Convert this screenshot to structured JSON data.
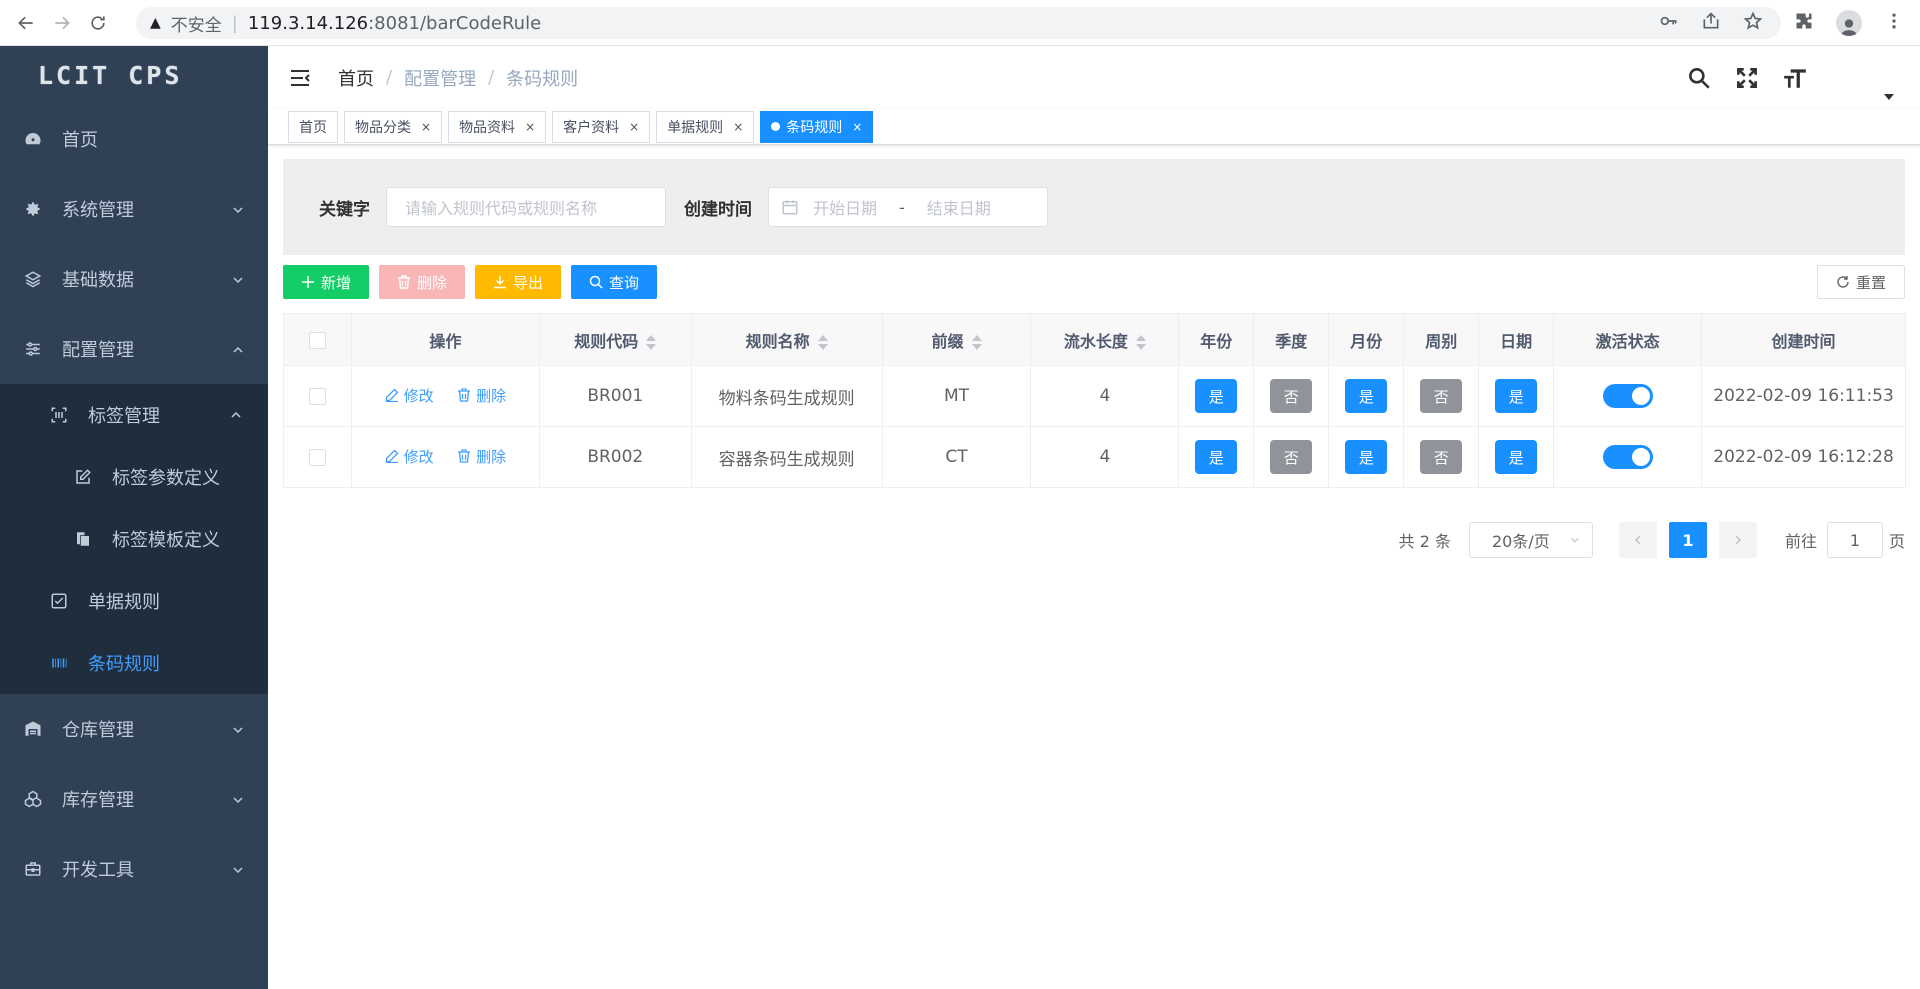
{
  "browser": {
    "insecure_label": "不安全",
    "url_host": "119.3.14.126",
    "url_rest": ":8081/barCodeRule"
  },
  "sidebar": {
    "logo": "LCIT CPS",
    "items": [
      {
        "label": "首页",
        "icon": "dashboard-icon"
      },
      {
        "label": "系统管理",
        "icon": "gear-icon"
      },
      {
        "label": "基础数据",
        "icon": "layers-icon"
      },
      {
        "label": "配置管理",
        "icon": "sliders-icon"
      },
      {
        "label": "标签管理",
        "icon": "barcode-scan-icon"
      },
      {
        "label": "标签参数定义",
        "icon": "edit-icon"
      },
      {
        "label": "标签模板定义",
        "icon": "copy-icon"
      },
      {
        "label": "单据规则",
        "icon": "checkbox-icon"
      },
      {
        "label": "条码规则",
        "icon": "barcode-icon"
      },
      {
        "label": "仓库管理",
        "icon": "warehouse-icon"
      },
      {
        "label": "库存管理",
        "icon": "cubes-icon"
      },
      {
        "label": "开发工具",
        "icon": "toolbox-icon"
      }
    ],
    "active_color": "#409eff"
  },
  "navbar": {
    "breadcrumb": [
      "首页",
      "配置管理",
      "条码规则"
    ]
  },
  "tags": [
    {
      "label": "首页",
      "closable": false
    },
    {
      "label": "物品分类",
      "closable": true
    },
    {
      "label": "物品资料",
      "closable": true
    },
    {
      "label": "客户资料",
      "closable": true
    },
    {
      "label": "单据规则",
      "closable": true
    },
    {
      "label": "条码规则",
      "closable": true,
      "active": true
    }
  ],
  "tag_close": "×",
  "search": {
    "keyword_label": "关键字",
    "keyword_placeholder": "请输入规则代码或规则名称",
    "created_label": "创建时间",
    "start_placeholder": "开始日期",
    "end_placeholder": "结束日期",
    "range_sep": "-"
  },
  "toolbar": {
    "add": "新增",
    "delete": "删除",
    "export": "导出",
    "query": "查询",
    "reset": "重置"
  },
  "table": {
    "headers": [
      "操作",
      "规则代码",
      "规则名称",
      "前缀",
      "流水长度",
      "年份",
      "季度",
      "月份",
      "周别",
      "日期",
      "激活状态",
      "创建时间"
    ],
    "edit_label": "修改",
    "delete_label": "删除",
    "rows": [
      {
        "code": "BR001",
        "name": "物料条码生成规则",
        "prefix": "MT",
        "length": "4",
        "year": "是",
        "quarter": "否",
        "month": "是",
        "week": "否",
        "day": "是",
        "active": true,
        "created": "2022-02-09 16:11:53"
      },
      {
        "code": "BR002",
        "name": "容器条码生成规则",
        "prefix": "CT",
        "length": "4",
        "year": "是",
        "quarter": "否",
        "month": "是",
        "week": "否",
        "day": "是",
        "active": true,
        "created": "2022-02-09 16:12:28"
      }
    ]
  },
  "pagination": {
    "total": "共 2 条",
    "page_size": "20条/页",
    "current": "1",
    "goto_label": "前往",
    "goto_value": "1",
    "page_suffix": "页"
  }
}
